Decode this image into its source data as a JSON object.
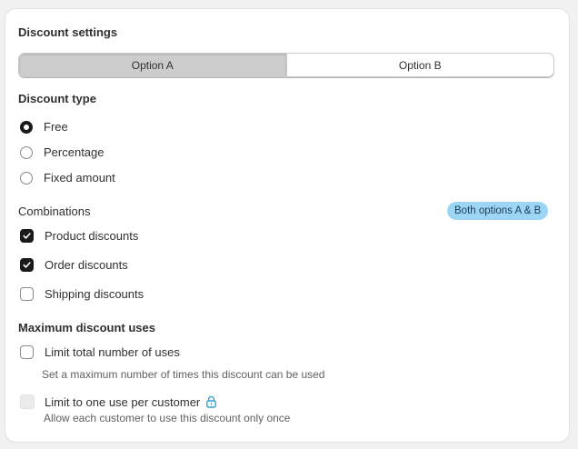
{
  "card": {
    "title": "Discount settings"
  },
  "options": {
    "tabs": [
      {
        "label": "Option A",
        "active": true
      },
      {
        "label": "Option B",
        "active": false
      }
    ]
  },
  "discount_type": {
    "heading": "Discount type",
    "choices": [
      {
        "label": "Free",
        "checked": true
      },
      {
        "label": "Percentage",
        "checked": false
      },
      {
        "label": "Fixed amount",
        "checked": false
      }
    ]
  },
  "combinations": {
    "heading": "Combinations",
    "badge": "Both options A & B",
    "items": [
      {
        "label": "Product discounts",
        "checked": true
      },
      {
        "label": "Order discounts",
        "checked": true
      },
      {
        "label": "Shipping discounts",
        "checked": false
      }
    ]
  },
  "max_uses": {
    "heading": "Maximum discount uses",
    "limit_total": {
      "label": "Limit total number of uses",
      "help": "Set a maximum number of times this discount can be used",
      "checked": false
    },
    "one_per_customer": {
      "label": "Limit to one use per customer",
      "help": "Allow each customer to use this discount only once",
      "checked": false,
      "disabled": true,
      "icon": "lock-icon"
    }
  },
  "colors": {
    "badge_bg": "#9dd6f5",
    "lock_icon": "#3aa1c9",
    "checked": "#1a1a1a"
  }
}
